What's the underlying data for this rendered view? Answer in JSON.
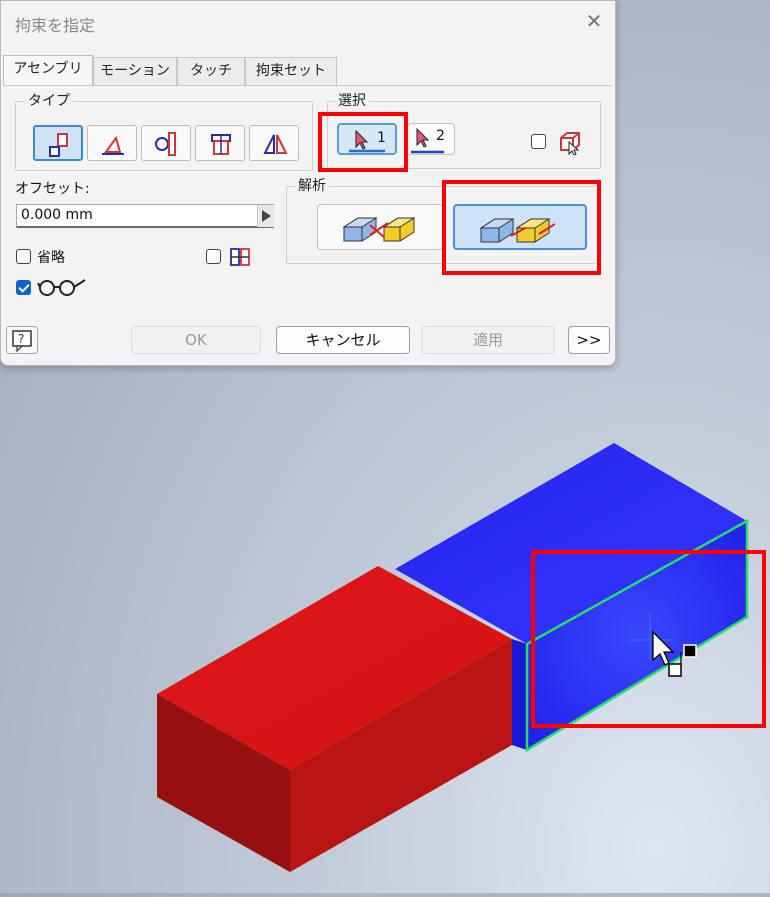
{
  "dialog": {
    "title": "拘束を指定",
    "close_glyph": "✕",
    "tabs": [
      {
        "label": "アセンブリ",
        "active": true
      },
      {
        "label": "モーション",
        "active": false
      },
      {
        "label": "タッチ",
        "active": false
      },
      {
        "label": "拘束セット",
        "active": false
      }
    ],
    "type_group_label": "タイプ",
    "type_buttons": [
      {
        "icon": "mate-constraint-icon",
        "selected": true
      },
      {
        "icon": "angle-constraint-icon",
        "selected": false
      },
      {
        "icon": "tangent-constraint-icon",
        "selected": false
      },
      {
        "icon": "insert-constraint-icon",
        "selected": false
      },
      {
        "icon": "symmetry-constraint-icon",
        "selected": false
      }
    ],
    "selection_group_label": "選択",
    "selection_buttons": [
      {
        "label": "1",
        "icon": "select-cursor-1-icon",
        "selected": true,
        "underline_color": "#1f6fd6"
      },
      {
        "label": "2",
        "icon": "select-cursor-2-icon",
        "selected": false,
        "underline_color": "#1f3fd6"
      }
    ],
    "first_part_pick": {
      "icon": "first-part-pick-icon",
      "checked": false
    },
    "offset_label": "オフセット:",
    "offset_value": "0.000 mm",
    "solution_group_label": "解析",
    "solution_buttons": [
      {
        "icon": "mate-solution-icon",
        "selected": false
      },
      {
        "icon": "flush-solution-icon",
        "selected": true
      }
    ],
    "predict_offset": {
      "label": "省略",
      "checked": false
    },
    "show_preview": {
      "icon": "glasses-icon",
      "checked": true
    },
    "limits": {
      "icon": "limits-icon",
      "checked": false
    },
    "footer": {
      "help_icon": "help-icon",
      "ok_label": "OK",
      "cancel_label": "キャンセル",
      "apply_label": "適用",
      "more_label": ">>"
    }
  },
  "colors": {
    "highlight_red": "#ff0000",
    "accent_blue": "#1f6fd6",
    "red_block": "#d41414",
    "blue_block": "#2a2af5",
    "edge_green": "#22e06a"
  },
  "viewport": {
    "red_block": "red-box-part",
    "blue_block": "blue-box-part",
    "cursor_icon": "mate-cursor-icon"
  }
}
